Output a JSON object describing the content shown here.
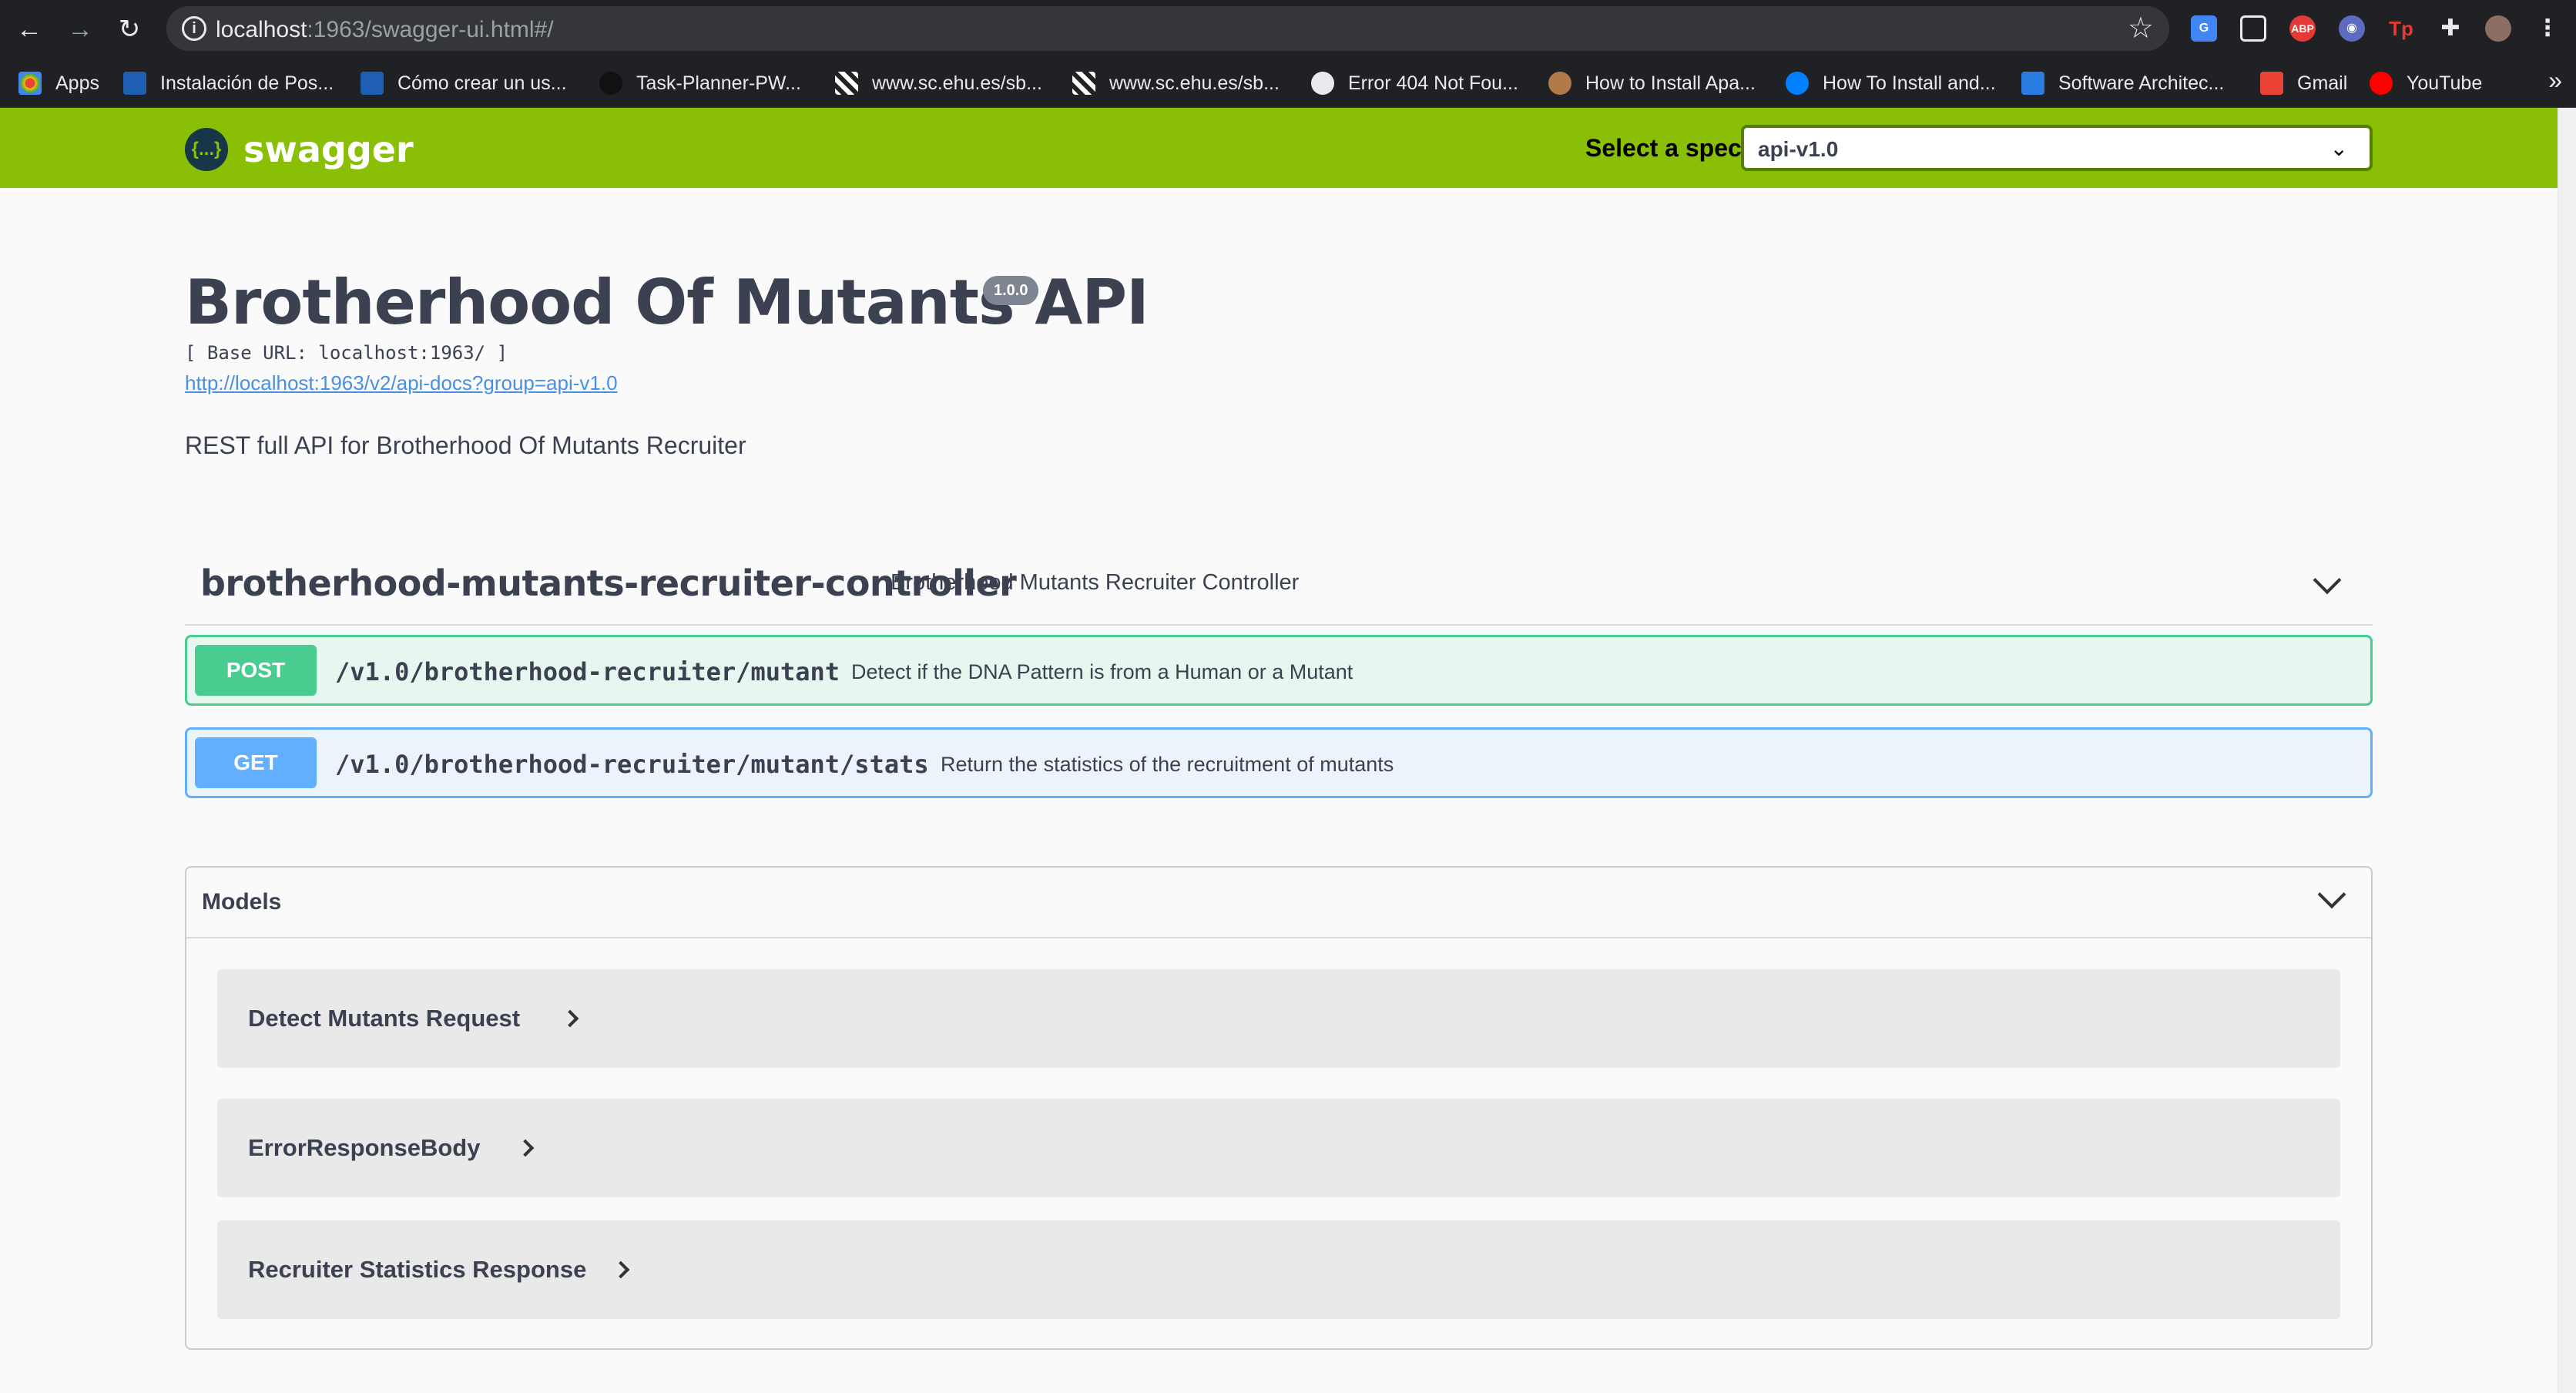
{
  "browser": {
    "url_host": "localhost",
    "url_rest": ":1963/swagger-ui.html#/",
    "bookmarks": [
      {
        "label": "Apps"
      },
      {
        "label": "Instalación de Pos..."
      },
      {
        "label": "Cómo crear un us..."
      },
      {
        "label": "Task-Planner-PW..."
      },
      {
        "label": "www.sc.ehu.es/sb..."
      },
      {
        "label": "www.sc.ehu.es/sb..."
      },
      {
        "label": "Error 404 Not Fou..."
      },
      {
        "label": "How to Install Apa..."
      },
      {
        "label": "How To Install and..."
      },
      {
        "label": "Software Architec..."
      },
      {
        "label": "Gmail"
      },
      {
        "label": "YouTube"
      }
    ],
    "extensions": [
      "ABP",
      "Tp"
    ]
  },
  "topbar": {
    "logo_text": "swagger",
    "logo_mark": "{...}",
    "spec_label": "Select a spec",
    "spec_value": "api-v1.0",
    "bg_color": "#89bf04"
  },
  "info": {
    "title": "Brotherhood Of Mutants API",
    "version": "1.0.0",
    "base_url": "[ Base URL: localhost:1963/ ]",
    "api_docs_link": "http://localhost:1963/v2/api-docs?group=api-v1.0",
    "description": "REST full API for Brotherhood Of Mutants Recruiter"
  },
  "tag": {
    "name": "brotherhood-mutants-recruiter-controller",
    "description": "Brotherhood Mutants Recruiter Controller"
  },
  "operations": [
    {
      "method": "POST",
      "path": "/v1.0/brotherhood-recruiter/mutant",
      "summary": "Detect if the DNA Pattern is from a Human or a Mutant",
      "color": "#49cc90"
    },
    {
      "method": "GET",
      "path": "/v1.0/brotherhood-recruiter/mutant/stats",
      "summary": "Return the statistics of the recruitment of mutants",
      "color": "#61affe"
    }
  ],
  "models": {
    "title": "Models",
    "items": [
      {
        "name": "Detect Mutants Request"
      },
      {
        "name": "ErrorResponseBody"
      },
      {
        "name": "Recruiter Statistics Response"
      }
    ]
  }
}
